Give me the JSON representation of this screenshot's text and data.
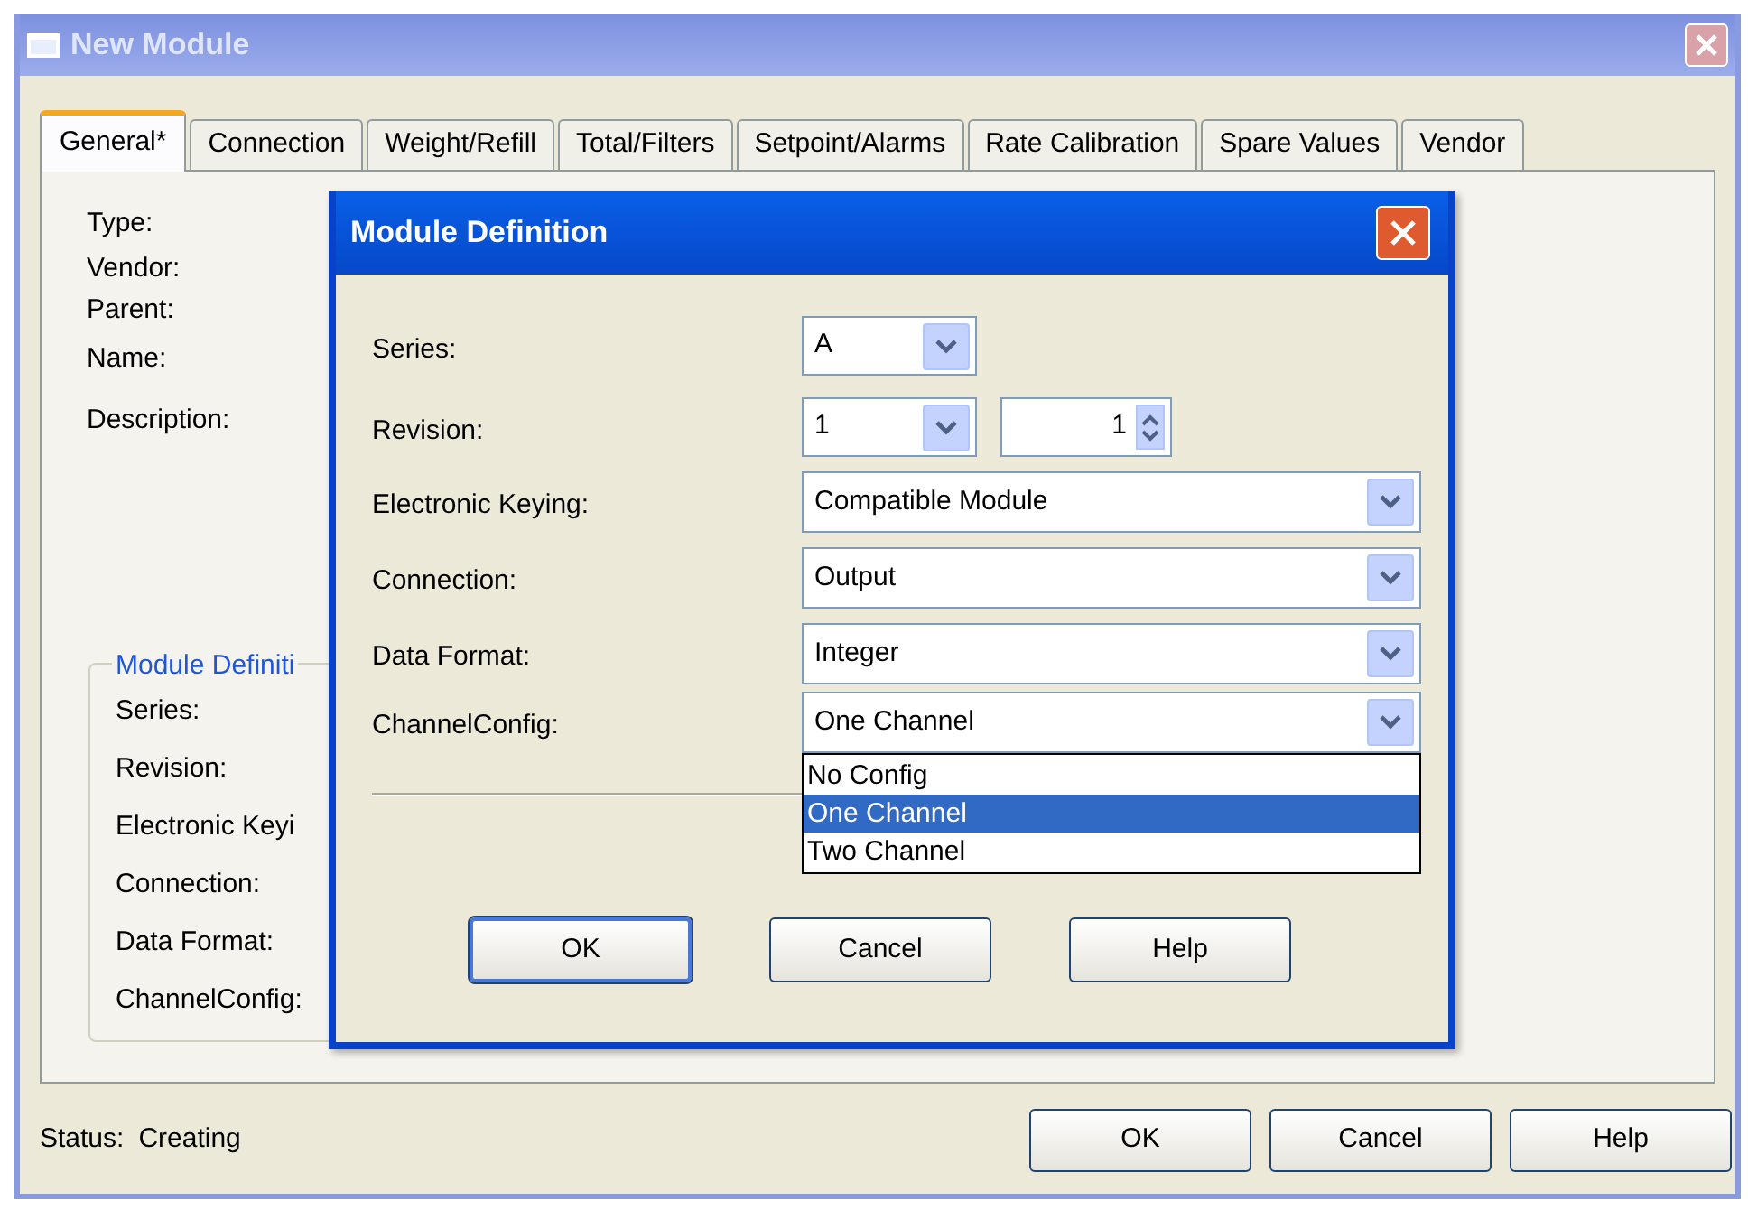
{
  "window": {
    "title": "New Module",
    "active": false
  },
  "tabs": [
    {
      "label": "General*",
      "selected": true
    },
    {
      "label": "Connection",
      "selected": false
    },
    {
      "label": "Weight/Refill",
      "selected": false
    },
    {
      "label": "Total/Filters",
      "selected": false
    },
    {
      "label": "Setpoint/Alarms",
      "selected": false
    },
    {
      "label": "Rate Calibration",
      "selected": false
    },
    {
      "label": "Spare Values",
      "selected": false
    },
    {
      "label": "Vendor",
      "selected": false
    }
  ],
  "general_labels": [
    "Type:",
    "Vendor:",
    "Parent:",
    "Name:",
    "Description:"
  ],
  "module_definition_group": {
    "legend": "Module Definiti",
    "labels": [
      "Series:",
      "Revision:",
      "Electronic Keyi",
      "Connection:",
      "Data Format:",
      "ChannelConfig:"
    ]
  },
  "status": {
    "label": "Status:",
    "value": "Creating"
  },
  "buttons": [
    {
      "label": "OK"
    },
    {
      "label": "Cancel"
    },
    {
      "label": "Help"
    }
  ],
  "dialog": {
    "title": "Module Definition",
    "active": true,
    "fields": [
      {
        "kind": "short_combo",
        "label": "Series:",
        "value": "A"
      },
      {
        "kind": "short_combo_spin",
        "label": "Revision:",
        "value": "1",
        "spin_value": "1"
      },
      {
        "kind": "combo",
        "label": "Electronic Keying:",
        "value": "Compatible Module"
      },
      {
        "kind": "combo",
        "label": "Connection:",
        "value": "Output"
      },
      {
        "kind": "combo",
        "label": "Data Format:",
        "value": "Integer"
      },
      {
        "kind": "combo",
        "label": "ChannelConfig:",
        "value": "One Channel",
        "expanded": true,
        "options": [
          {
            "label": "No Config",
            "selected": false
          },
          {
            "label": "One Channel",
            "selected": true
          },
          {
            "label": "Two Channel",
            "selected": false
          }
        ]
      }
    ],
    "buttons": [
      {
        "label": "OK",
        "default": true
      },
      {
        "label": "Cancel",
        "default": false
      },
      {
        "label": "Help",
        "default": false
      }
    ]
  }
}
